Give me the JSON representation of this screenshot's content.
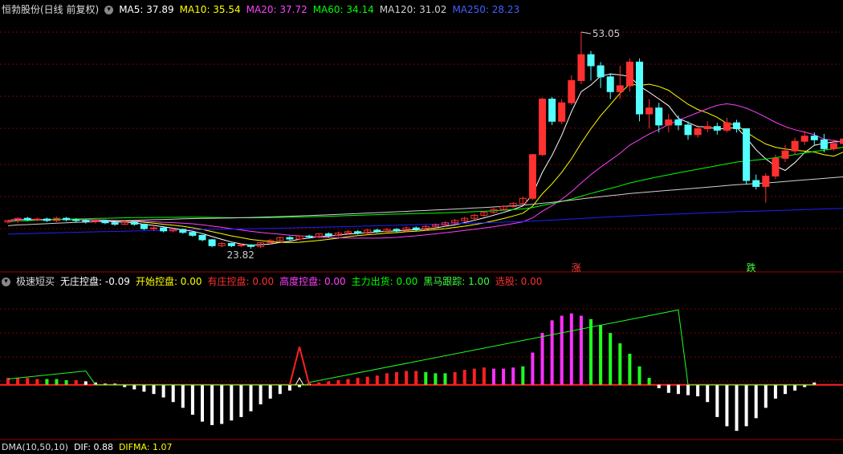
{
  "colors": {
    "bg": "#000000",
    "grid": "#800000",
    "up": "#ff3030",
    "down": "#54ffff",
    "ma5": "#ffffff",
    "ma10": "#ffff00",
    "ma20": "#ff40ff",
    "ma60": "#00ff00",
    "ma120": "#d0d0d0",
    "ma250": "#2020ff"
  },
  "main_header": {
    "title": "恒勃股份(日线 前复权)",
    "ma5": "MA5: 37.89",
    "ma10": "MA10: 35.54",
    "ma20": "MA20: 37.72",
    "ma60": "MA60: 34.14",
    "ma120": "MA120: 31.02",
    "ma250": "MA250: 28.23"
  },
  "main_annotations": {
    "high": "53.05",
    "low": "23.82",
    "rise": "涨",
    "fall": "跌"
  },
  "indicator_header": {
    "title": "极速短买",
    "v1": "无庄控盘: -0.09",
    "v2": "开始控盘: 0.00",
    "v3": "有庄控盘: 0.00",
    "v4": "高度控盘: 0.00",
    "v5": "主力出货: 0.00",
    "v6": "黑马跟踪: 1.00",
    "v7": "选股: 0.00"
  },
  "bottom_header": {
    "title": "DMA(10,50,10)",
    "dif": "DIF: 0.88",
    "difma": "DIFMA: 1.07"
  },
  "chart_data": {
    "type": "candlestick",
    "ylim": [
      22.5,
      55
    ],
    "candles": [
      [
        27.4,
        27.6,
        27.2,
        27.7
      ],
      [
        27.6,
        27.9,
        27.3,
        28.0
      ],
      [
        27.9,
        27.7,
        27.5,
        28.1
      ],
      [
        27.7,
        27.8,
        27.5,
        28.0
      ],
      [
        27.8,
        27.6,
        27.4,
        28.0
      ],
      [
        27.6,
        27.9,
        27.4,
        28.1
      ],
      [
        27.9,
        27.7,
        27.5,
        28.1
      ],
      [
        27.7,
        27.6,
        27.3,
        27.9
      ],
      [
        27.6,
        27.5,
        27.2,
        27.8
      ],
      [
        27.5,
        27.6,
        27.2,
        27.8
      ],
      [
        27.6,
        27.3,
        27.1,
        27.7
      ],
      [
        27.3,
        27.1,
        26.9,
        27.5
      ],
      [
        27.1,
        27.4,
        27.0,
        27.6
      ],
      [
        27.4,
        27.1,
        26.9,
        27.5
      ],
      [
        27.1,
        26.5,
        26.3,
        27.2
      ],
      [
        26.5,
        26.6,
        26.2,
        26.8
      ],
      [
        26.6,
        26.2,
        26.0,
        26.7
      ],
      [
        26.2,
        26.4,
        26.0,
        26.6
      ],
      [
        26.4,
        26.0,
        25.8,
        26.5
      ],
      [
        26.0,
        25.6,
        25.4,
        26.1
      ],
      [
        25.6,
        25.0,
        24.8,
        25.7
      ],
      [
        25.0,
        24.2,
        24.0,
        25.1
      ],
      [
        24.2,
        24.5,
        24.0,
        24.7
      ],
      [
        24.5,
        24.2,
        24.0,
        24.6
      ],
      [
        24.2,
        24.3,
        24.0,
        24.5
      ],
      [
        24.3,
        24.1,
        23.8,
        24.4
      ],
      [
        24.1,
        24.6,
        23.9,
        24.7
      ],
      [
        24.6,
        24.9,
        24.4,
        25.1
      ],
      [
        24.9,
        25.3,
        24.7,
        25.4
      ],
      [
        25.3,
        25.1,
        24.9,
        25.5
      ],
      [
        25.1,
        25.5,
        24.9,
        25.6
      ],
      [
        25.5,
        25.4,
        25.2,
        25.7
      ],
      [
        25.4,
        25.8,
        25.2,
        25.9
      ],
      [
        25.8,
        25.6,
        25.3,
        26.0
      ],
      [
        25.6,
        25.9,
        25.4,
        26.1
      ],
      [
        25.9,
        26.1,
        25.7,
        26.3
      ],
      [
        26.1,
        25.9,
        25.7,
        26.3
      ],
      [
        25.9,
        26.3,
        25.7,
        26.5
      ],
      [
        26.3,
        26.1,
        25.9,
        26.5
      ],
      [
        26.1,
        26.4,
        26.0,
        26.6
      ],
      [
        26.4,
        26.2,
        26.0,
        26.6
      ],
      [
        26.2,
        26.6,
        26.0,
        26.8
      ],
      [
        26.6,
        26.4,
        26.2,
        26.8
      ],
      [
        26.4,
        26.8,
        26.2,
        27.0
      ],
      [
        26.8,
        27.0,
        26.6,
        27.2
      ],
      [
        27.0,
        27.3,
        26.8,
        27.5
      ],
      [
        27.3,
        27.6,
        27.1,
        27.8
      ],
      [
        27.6,
        27.9,
        27.4,
        28.1
      ],
      [
        27.9,
        28.3,
        27.7,
        28.5
      ],
      [
        28.3,
        28.7,
        28.1,
        28.9
      ],
      [
        28.7,
        29.1,
        28.5,
        29.3
      ],
      [
        29.1,
        29.5,
        28.9,
        29.7
      ],
      [
        29.5,
        29.9,
        29.3,
        30.1
      ],
      [
        29.9,
        30.6,
        29.7,
        30.8
      ],
      [
        30.6,
        36.5,
        30.4,
        36.6
      ],
      [
        36.5,
        44.0,
        36.3,
        44.2
      ],
      [
        44.0,
        41.0,
        40.5,
        44.3
      ],
      [
        41.0,
        43.5,
        40.6,
        44.0
      ],
      [
        43.5,
        46.5,
        43.2,
        47.2
      ],
      [
        46.5,
        50.0,
        46.0,
        53.05
      ],
      [
        50.0,
        48.5,
        46.5,
        50.5
      ],
      [
        48.5,
        47.0,
        45.5,
        49.0
      ],
      [
        47.0,
        45.0,
        44.0,
        47.5
      ],
      [
        45.0,
        45.8,
        44.0,
        48.5
      ],
      [
        45.8,
        49.0,
        45.0,
        49.5
      ],
      [
        49.0,
        42.0,
        41.0,
        49.5
      ],
      [
        42.0,
        42.8,
        40.0,
        44.0
      ],
      [
        42.8,
        40.5,
        39.5,
        43.5
      ],
      [
        40.5,
        41.2,
        39.5,
        42.0
      ],
      [
        41.2,
        40.5,
        39.8,
        41.8
      ],
      [
        40.5,
        39.2,
        38.5,
        41.0
      ],
      [
        39.2,
        40.0,
        38.8,
        40.5
      ],
      [
        40.0,
        40.3,
        39.5,
        41.0
      ],
      [
        40.3,
        39.8,
        39.2,
        40.8
      ],
      [
        39.8,
        40.8,
        39.5,
        41.5
      ],
      [
        40.8,
        40.0,
        39.5,
        41.2
      ],
      [
        40.0,
        33.0,
        32.5,
        37.5
      ],
      [
        33.0,
        32.2,
        31.8,
        33.8
      ],
      [
        32.2,
        33.6,
        30.0,
        34.0
      ],
      [
        33.6,
        36.0,
        33.2,
        36.5
      ],
      [
        36.0,
        37.0,
        35.5,
        37.8
      ],
      [
        37.0,
        38.3,
        36.5,
        38.8
      ],
      [
        38.3,
        39.0,
        37.8,
        39.7
      ],
      [
        39.0,
        38.5,
        37.8,
        39.5
      ],
      [
        38.5,
        37.3,
        36.8,
        39.3
      ],
      [
        37.3,
        38.0,
        37.0,
        38.5
      ],
      [
        38.0,
        38.6,
        37.5,
        39.0
      ]
    ],
    "series": [
      {
        "name": "MA5"
      },
      {
        "name": "MA10"
      },
      {
        "name": "MA20"
      },
      {
        "name": "MA60"
      },
      {
        "name": "MA120"
      },
      {
        "name": "MA250"
      }
    ]
  },
  "indicator_data": {
    "ylim": [
      -4.2,
      8.2
    ],
    "bars": [
      0.6,
      0.6,
      0.6,
      0.5,
      0.5,
      0.5,
      0.4,
      0.4,
      0.3,
      0.2,
      0.1,
      0.1,
      -0.2,
      -0.4,
      -0.6,
      -0.8,
      -1.1,
      -1.5,
      -2.0,
      -2.6,
      -3.2,
      -3.5,
      -3.4,
      -3.1,
      -2.8,
      -2.3,
      -1.7,
      -1.2,
      -0.8,
      -0.5,
      -0.2,
      0.1,
      0.2,
      0.3,
      0.4,
      0.5,
      0.6,
      0.7,
      0.8,
      1.0,
      1.1,
      1.2,
      1.2,
      1.1,
      1.0,
      1.0,
      1.1,
      1.3,
      1.4,
      1.5,
      1.4,
      1.4,
      1.5,
      1.6,
      2.8,
      4.5,
      5.6,
      6.0,
      6.2,
      6.0,
      5.7,
      5.2,
      4.5,
      3.6,
      2.7,
      1.6,
      0.6,
      -0.3,
      -0.7,
      -0.8,
      -0.9,
      -1.0,
      -1.5,
      -2.8,
      -3.6,
      -4.0,
      -3.6,
      -2.9,
      -2.0,
      -1.2,
      -0.8,
      -0.5,
      -0.2,
      0.2
    ],
    "bar_colors": [
      "r",
      "r",
      "r",
      "r",
      "g",
      "g",
      "g",
      "r",
      "w",
      "w",
      "w",
      "w",
      "w",
      "w",
      "w",
      "w",
      "w",
      "w",
      "w",
      "w",
      "w",
      "w",
      "w",
      "w",
      "w",
      "w",
      "w",
      "w",
      "w",
      "w",
      "w",
      "w",
      "r",
      "r",
      "r",
      "r",
      "r",
      "r",
      "r",
      "r",
      "r",
      "r",
      "r",
      "g",
      "g",
      "g",
      "r",
      "r",
      "r",
      "r",
      "m",
      "m",
      "m",
      "g",
      "m",
      "m",
      "m",
      "m",
      "m",
      "m",
      "g",
      "g",
      "g",
      "g",
      "g",
      "g",
      "g",
      "w",
      "w",
      "w",
      "w",
      "w",
      "w",
      "w",
      "w",
      "w",
      "w",
      "w",
      "w",
      "w",
      "w",
      "w",
      "w",
      "w"
    ]
  }
}
